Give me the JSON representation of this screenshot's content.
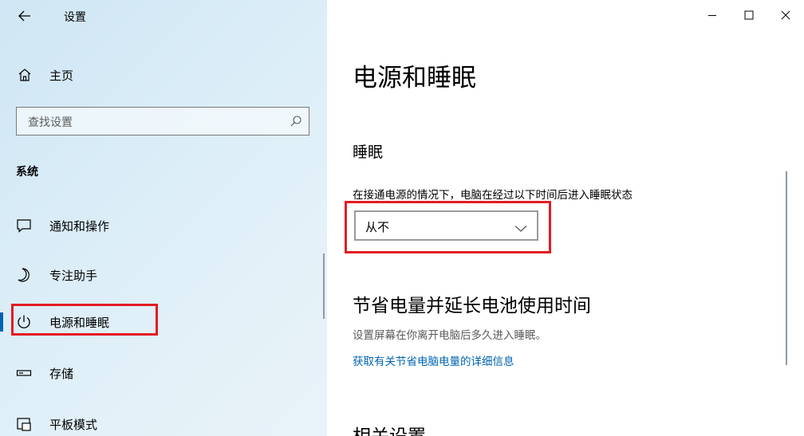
{
  "window": {
    "title": "设置"
  },
  "sidebar": {
    "home_label": "主页",
    "search_placeholder": "查找设置",
    "section_title": "系统",
    "items": [
      {
        "label": "通知和操作",
        "icon": "notification-icon"
      },
      {
        "label": "专注助手",
        "icon": "moon-icon"
      },
      {
        "label": "电源和睡眠",
        "icon": "power-icon",
        "active": true
      },
      {
        "label": "存储",
        "icon": "storage-icon"
      },
      {
        "label": "平板模式",
        "icon": "tablet-mode-icon"
      }
    ]
  },
  "main": {
    "title": "电源和睡眠",
    "sleep": {
      "heading": "睡眠",
      "description": "在接通电源的情况下，电脑在经过以下时间后进入睡眠状态",
      "dropdown_value": "从不"
    },
    "battery": {
      "heading": "节省电量并延长电池使用时间",
      "description": "设置屏幕在你离开电脑后多久进入睡眠。",
      "link": "获取有关节省电脑电量的详细信息"
    },
    "related_heading": "相关设置"
  },
  "colors": {
    "accent": "#0063b1",
    "highlight": "#e31c23"
  }
}
